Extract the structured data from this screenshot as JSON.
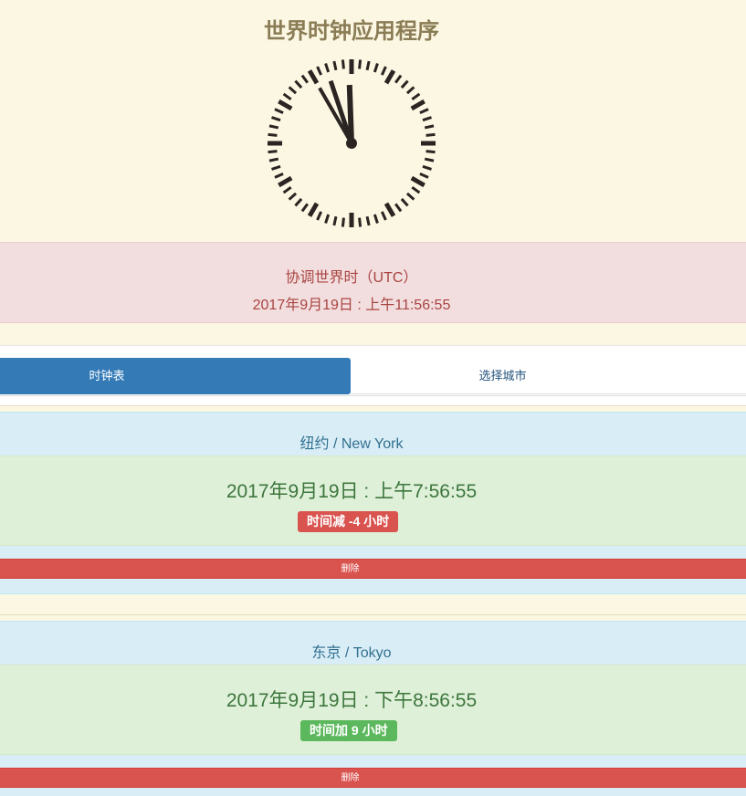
{
  "app": {
    "title": "世界时钟应用程序"
  },
  "clock": {
    "hour": 11,
    "minute": 56,
    "second": 55
  },
  "utc": {
    "label": "协调世界时（UTC）",
    "time": "2017年9月19日 : 上午11:56:55"
  },
  "tabs": [
    {
      "label": "时钟表",
      "active": true
    },
    {
      "label": "选择城市",
      "active": false
    }
  ],
  "cities": [
    {
      "name": "纽约 / New York",
      "time": "2017年9月19日 : 上午7:56:55",
      "offset_label": "时间减 -4 小时",
      "offset_color": "#d9534f",
      "delete_label": "删除"
    },
    {
      "name": "东京 / Tokyo",
      "time": "2017年9月19日 : 下午8:56:55",
      "offset_label": "时间加 9 小时",
      "offset_color": "#5cb85c",
      "delete_label": "删除"
    }
  ],
  "colors": {
    "background": "#fcf7e2",
    "primary": "#337ab7",
    "danger": "#d9534f",
    "success": "#5cb85c",
    "info_bg": "#d9edf7",
    "success_bg": "#dff0d8",
    "error_bg": "#f2dede"
  }
}
